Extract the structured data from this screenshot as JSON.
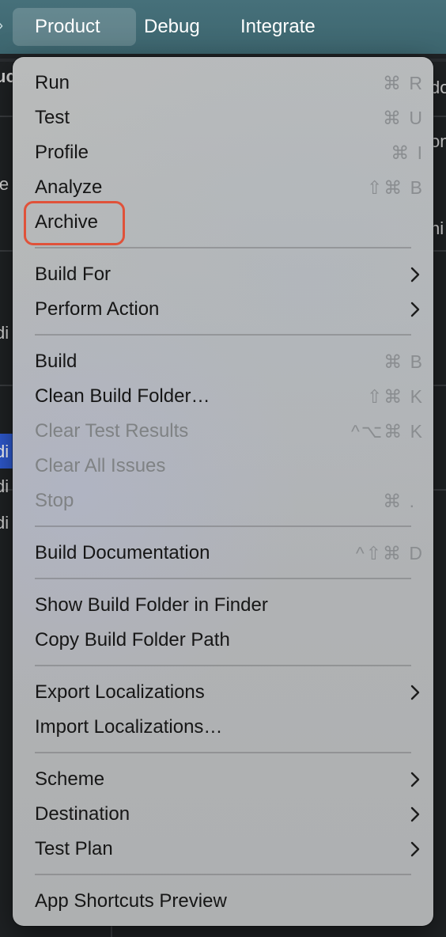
{
  "menubar": {
    "items": [
      {
        "label": "Product",
        "active": true
      },
      {
        "label": "Debug",
        "active": false
      },
      {
        "label": "Integrate",
        "active": false
      }
    ]
  },
  "background": {
    "left_fragments": [
      "uc",
      "ie",
      "di",
      "di",
      "di",
      "di"
    ],
    "right_fragments": [
      "do",
      "on",
      "hi"
    ]
  },
  "menu": {
    "highlight_color": "#e0523a",
    "sections": [
      {
        "items": [
          {
            "label": "Run",
            "shortcut": "⌘ R"
          },
          {
            "label": "Test",
            "shortcut": "⌘ U"
          },
          {
            "label": "Profile",
            "shortcut": "⌘ I"
          },
          {
            "label": "Analyze",
            "shortcut": "⇧⌘ B"
          },
          {
            "label": "Archive",
            "shortcut": "",
            "highlighted": true
          }
        ]
      },
      {
        "items": [
          {
            "label": "Build For",
            "submenu": true
          },
          {
            "label": "Perform Action",
            "submenu": true
          }
        ]
      },
      {
        "items": [
          {
            "label": "Build",
            "shortcut": "⌘ B"
          },
          {
            "label": "Clean Build Folder…",
            "shortcut": "⇧⌘ K"
          },
          {
            "label": "Clear Test Results",
            "shortcut": "^⌥⌘ K",
            "disabled": true
          },
          {
            "label": "Clear All Issues",
            "shortcut": "",
            "disabled": true
          },
          {
            "label": "Stop",
            "shortcut": "⌘ .",
            "disabled": true
          }
        ]
      },
      {
        "items": [
          {
            "label": "Build Documentation",
            "shortcut": "^⇧⌘ D"
          }
        ]
      },
      {
        "items": [
          {
            "label": "Show Build Folder in Finder",
            "shortcut": ""
          },
          {
            "label": "Copy Build Folder Path",
            "shortcut": ""
          }
        ]
      },
      {
        "items": [
          {
            "label": "Export Localizations",
            "submenu": true
          },
          {
            "label": "Import Localizations…",
            "shortcut": ""
          }
        ]
      },
      {
        "items": [
          {
            "label": "Scheme",
            "submenu": true
          },
          {
            "label": "Destination",
            "submenu": true
          },
          {
            "label": "Test Plan",
            "submenu": true
          }
        ]
      },
      {
        "items": [
          {
            "label": "App Shortcuts Preview",
            "shortcut": ""
          }
        ]
      }
    ]
  }
}
